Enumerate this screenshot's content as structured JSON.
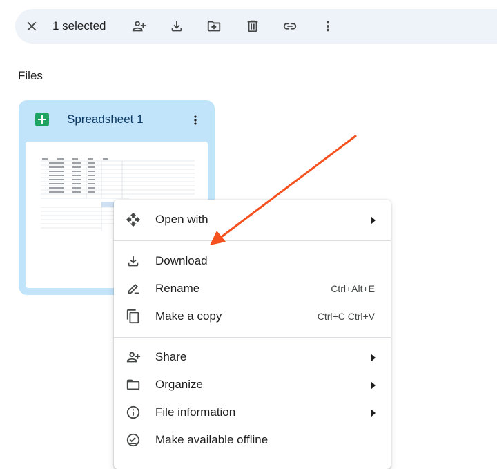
{
  "toolbar": {
    "selected_label": "1 selected",
    "icons": [
      "close-icon",
      "share-person-add-icon",
      "download-icon",
      "move-folder-icon",
      "trash-icon",
      "link-icon",
      "more-vert-icon"
    ]
  },
  "section_title": "Files",
  "file_card": {
    "title": "Spreadsheet 1",
    "icon": "google-sheets-icon",
    "accent": "#1ea362"
  },
  "context_menu": {
    "items": [
      {
        "label": "Open with",
        "icon": "open-with-icon",
        "submenu": true
      },
      {
        "label": "Download",
        "icon": "download-icon"
      },
      {
        "label": "Rename",
        "icon": "rename-icon",
        "shortcut": "Ctrl+Alt+E"
      },
      {
        "label": "Make a copy",
        "icon": "copy-icon",
        "shortcut": "Ctrl+C Ctrl+V"
      },
      {
        "label": "Share",
        "icon": "share-person-add-icon",
        "submenu": true
      },
      {
        "label": "Organize",
        "icon": "folder-icon",
        "submenu": true
      },
      {
        "label": "File information",
        "icon": "info-icon",
        "submenu": true
      },
      {
        "label": "Make available offline",
        "icon": "offline-check-icon"
      }
    ]
  },
  "colors": {
    "toolbar_bg": "#eef2f9",
    "card_bg": "#c2e4fb",
    "annotation_arrow": "#f4511e"
  }
}
